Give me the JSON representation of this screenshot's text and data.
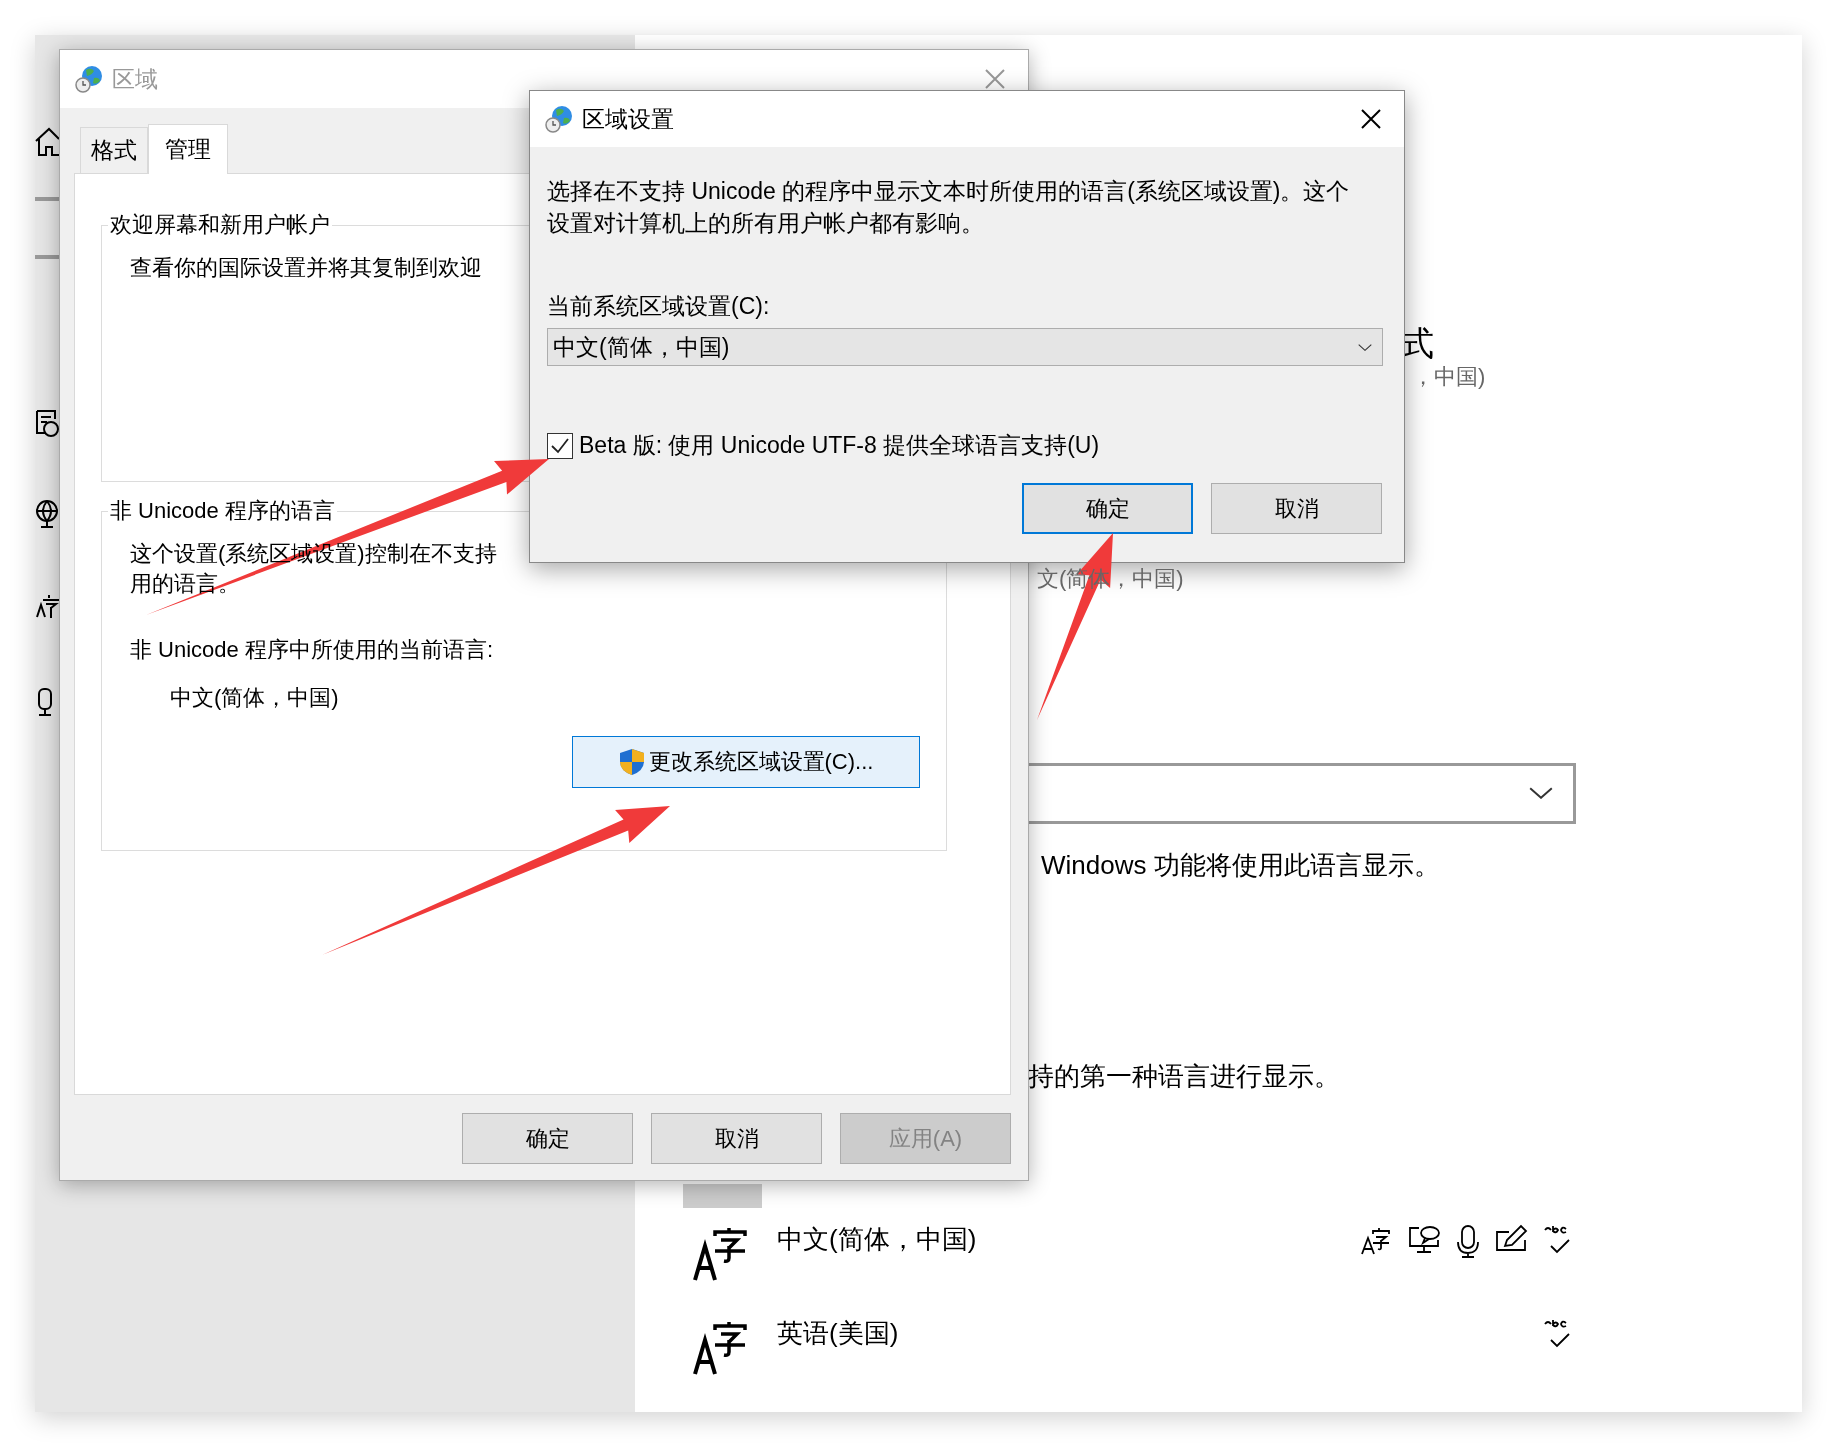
{
  "settings_window": {
    "heading_fragment": "式",
    "subtitle_fragment": "，中国)",
    "language_fragment": "文(简体，中国)",
    "windows_display_note": "Windows 功能将使用此语言显示。",
    "fallback_note": "持的第一种语言进行显示。",
    "languages": [
      {
        "name": "中文(简体，中国)",
        "feature_icons": [
          {
            "kind": "font"
          },
          {
            "kind": "speech"
          },
          {
            "kind": "mic"
          },
          {
            "kind": "pen"
          },
          {
            "kind": "spell"
          }
        ]
      },
      {
        "name": "英语(美国)",
        "feature_icons": [
          {
            "kind": "spell"
          }
        ]
      }
    ]
  },
  "region_dialog": {
    "title": "区域",
    "tabs": [
      {
        "label": "格式",
        "selected": false
      },
      {
        "label": "管理",
        "selected": true
      }
    ],
    "welcome_group": {
      "title": "欢迎屏幕和新用户帐户",
      "text": "查看你的国际设置并将其复制到欢迎"
    },
    "non_unicode_group": {
      "title": "非 Unicode 程序的语言",
      "description_lines": [
        "这个设置(系统区域设置)控制在不支持",
        "用的语言。"
      ],
      "current_label": "非 Unicode 程序中所使用的当前语言:",
      "current_value": "中文(简体，中国)",
      "change_button": "更改系统区域设置(C)..."
    },
    "buttons": [
      {
        "label": "确定",
        "disabled": false
      },
      {
        "label": "取消",
        "disabled": false
      },
      {
        "label": "应用(A)",
        "disabled": true
      }
    ]
  },
  "locale_dialog": {
    "title": "区域设置",
    "description": "选择在不支持 Unicode 的程序中显示文本时所使用的语言(系统区域设置)。这个设置对计算机上的所有用户帐户都有影响。",
    "current_label": "当前系统区域设置(C):",
    "dropdown_value": "中文(简体，中国)",
    "beta_checkbox": {
      "label": "Beta 版: 使用 Unicode UTF-8 提供全球语言支持(U)",
      "checked": true
    },
    "buttons": [
      {
        "label": "确定",
        "focused": true
      },
      {
        "label": "取消",
        "focused": false
      }
    ]
  }
}
